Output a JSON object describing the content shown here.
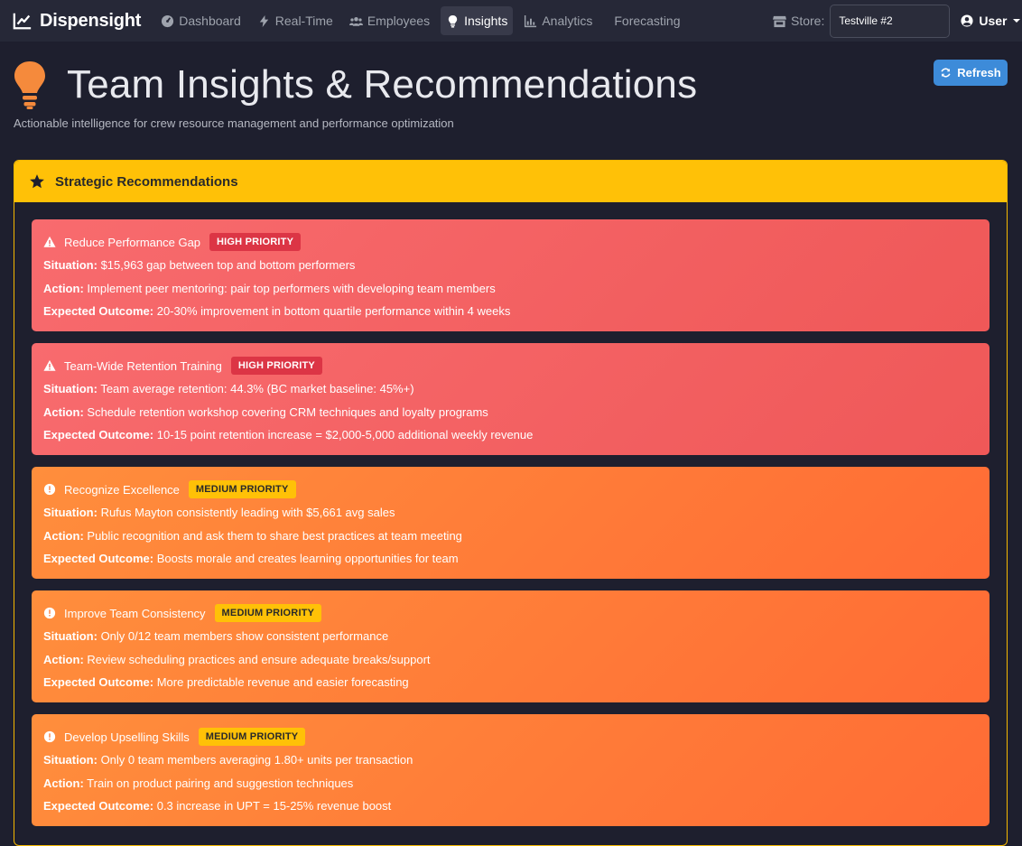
{
  "navbar": {
    "brand": "Dispensight",
    "items": [
      {
        "label": "Dashboard",
        "icon": "tachometer-icon",
        "active": false
      },
      {
        "label": "Real-Time",
        "icon": "bolt-icon",
        "active": false
      },
      {
        "label": "Employees",
        "icon": "users-icon",
        "active": false
      },
      {
        "label": "Insights",
        "icon": "lightbulb-icon",
        "active": true
      },
      {
        "label": "Analytics",
        "icon": "chart-bar-icon",
        "active": false
      },
      {
        "label": "Forecasting",
        "icon": "",
        "active": false
      }
    ],
    "store_label": "Store:",
    "store_value": "Testville #2",
    "user_label": "User"
  },
  "header": {
    "title": "Team Insights & Recommendations",
    "subtitle": "Actionable intelligence for crew resource management and performance optimization",
    "refresh_label": "Refresh"
  },
  "card": {
    "title": "Strategic Recommendations"
  },
  "labels": {
    "situation": "Situation:",
    "action": "Action:",
    "outcome": "Expected Outcome:"
  },
  "recommendations": [
    {
      "title": "Reduce Performance Gap",
      "priority": "HIGH PRIORITY",
      "situation": "$15,963 gap between top and bottom performers",
      "action": "Implement peer mentoring: pair top performers with developing team members",
      "outcome": "20-30% improvement in bottom quartile performance within 4 weeks"
    },
    {
      "title": "Team-Wide Retention Training",
      "priority": "HIGH PRIORITY",
      "situation": "Team average retention: 44.3% (BC market baseline: 45%+)",
      "action": "Schedule retention workshop covering CRM techniques and loyalty programs",
      "outcome": "10-15 point retention increase = $2,000-5,000 additional weekly revenue"
    },
    {
      "title": "Recognize Excellence",
      "priority": "MEDIUM PRIORITY",
      "situation": "Rufus Mayton consistently leading with $5,661 avg sales",
      "action": "Public recognition and ask them to share best practices at team meeting",
      "outcome": "Boosts morale and creates learning opportunities for team"
    },
    {
      "title": "Improve Team Consistency",
      "priority": "MEDIUM PRIORITY",
      "situation": "Only 0/12 team members show consistent performance",
      "action": "Review scheduling practices and ensure adequate breaks/support",
      "outcome": "More predictable revenue and easier forecasting"
    },
    {
      "title": "Develop Upselling Skills",
      "priority": "MEDIUM PRIORITY",
      "situation": "Only 0 team members averaging 1.80+ units per transaction",
      "action": "Train on product pairing and suggestion techniques",
      "outcome": "0.3 increase in UPT = 15-25% revenue boost"
    }
  ],
  "colors": {
    "background": "#1e1f2e",
    "navbar": "#262837",
    "accent": "#ffc107",
    "high": "#f06060",
    "medium": "#ff7a38",
    "primary": "#3d8bd9"
  }
}
